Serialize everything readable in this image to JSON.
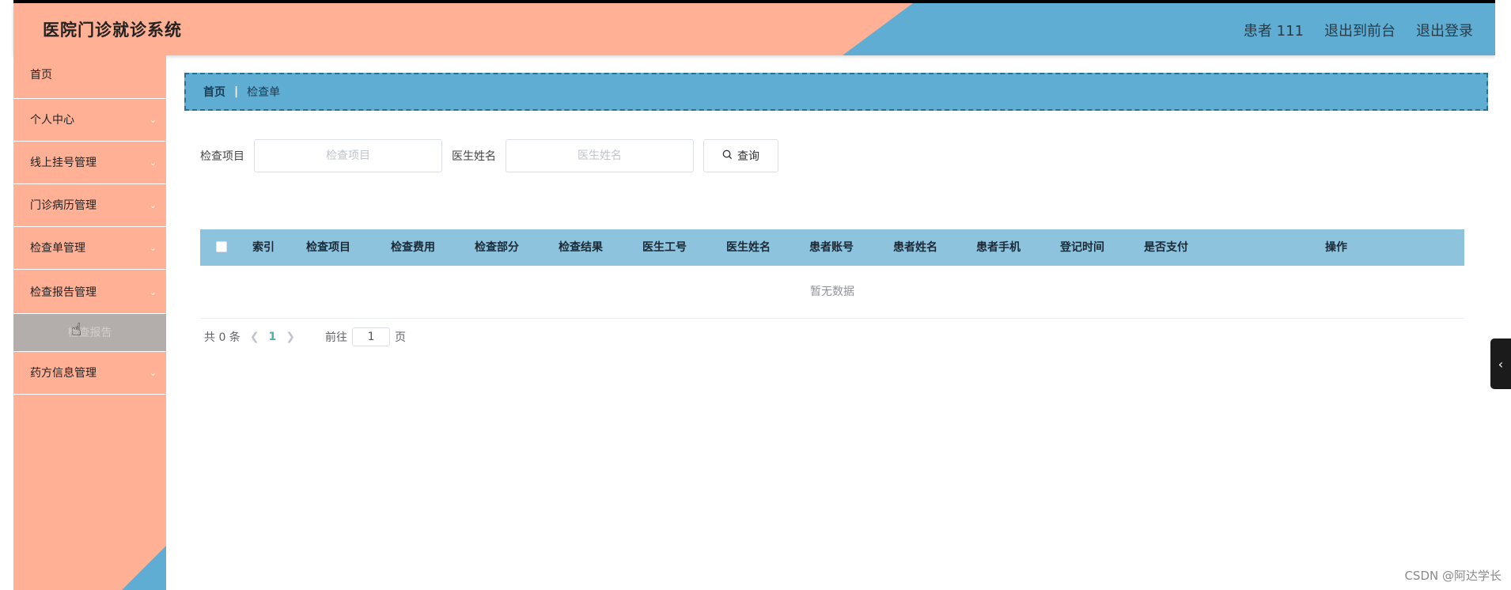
{
  "header": {
    "title": "医院门诊就诊系统",
    "links": [
      "患者 111",
      "退出到前台",
      "退出登录"
    ]
  },
  "sidebar": {
    "items": [
      {
        "label": "首页",
        "has_arrow": false
      },
      {
        "label": "个人中心",
        "has_arrow": true
      },
      {
        "label": "线上挂号管理",
        "has_arrow": true
      },
      {
        "label": "门诊病历管理",
        "has_arrow": true
      },
      {
        "label": "检查单管理",
        "has_arrow": true
      },
      {
        "label": "检查报告管理",
        "has_arrow": true
      },
      {
        "label": "药方信息管理",
        "has_arrow": true
      }
    ],
    "submenu_label": "检查报告"
  },
  "breadcrumb": {
    "home": "首页",
    "separator": "|",
    "current": "检查单"
  },
  "search": {
    "field1_label": "检查项目",
    "field1_placeholder": "检查项目",
    "field2_label": "医生姓名",
    "field2_placeholder": "医生姓名",
    "button_label": "查询"
  },
  "table": {
    "columns": [
      "索引",
      "检查项目",
      "检查费用",
      "检查部分",
      "检查结果",
      "医生工号",
      "医生姓名",
      "患者账号",
      "患者姓名",
      "患者手机",
      "登记时间",
      "是否支付",
      "操作"
    ],
    "empty_text": "暂无数据"
  },
  "pagination": {
    "total": "共 0 条",
    "current_page": "1",
    "goto_label": "前往",
    "goto_value": "1",
    "page_suffix": "页"
  },
  "watermark": "CSDN @阿达学长",
  "colors": {
    "salmon": "#ffb095",
    "blue": "#5fadd3",
    "table_header": "#8ec3dd"
  }
}
